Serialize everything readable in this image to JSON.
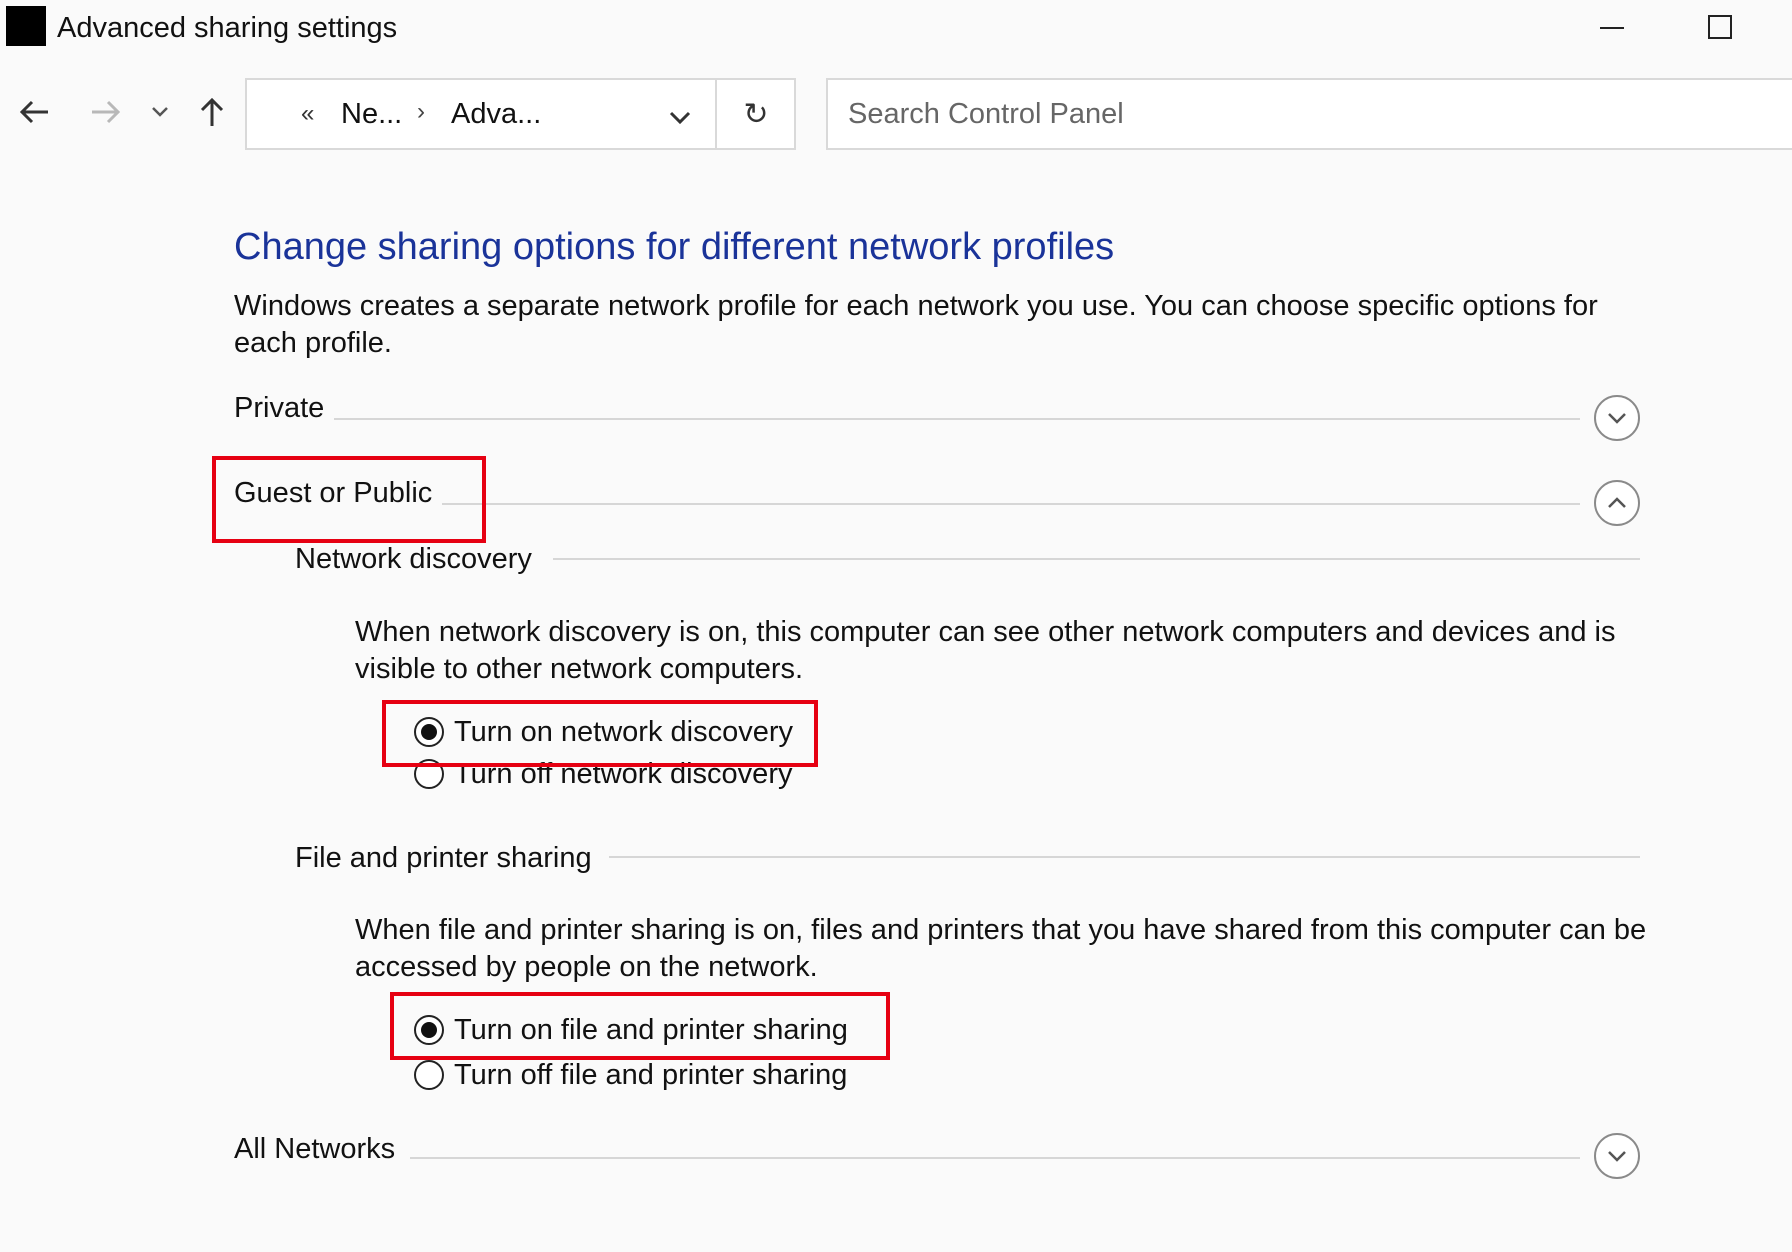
{
  "window": {
    "title": "Advanced sharing settings"
  },
  "navbar": {
    "breadcrumb_overflow": "«",
    "crumbs": [
      "Ne...",
      "Adva..."
    ],
    "crumb_separator": "›",
    "search_placeholder": "Search Control Panel"
  },
  "page": {
    "heading": "Change sharing options for different network profiles",
    "intro": "Windows creates a separate network profile for each network you use. You can choose specific options for each profile."
  },
  "profiles": {
    "private": {
      "label": "Private",
      "expanded": false
    },
    "guest_public": {
      "label": "Guest or Public",
      "expanded": true,
      "network_discovery": {
        "label": "Network discovery",
        "description": "When network discovery is on, this computer can see other network computers and devices and is visible to other network computers.",
        "options": [
          {
            "label": "Turn on network discovery",
            "checked": true
          },
          {
            "label": "Turn off network discovery",
            "checked": false
          }
        ]
      },
      "file_printer_sharing": {
        "label": "File and printer sharing",
        "description": "When file and printer sharing is on, files and printers that you have shared from this computer can be accessed by people on the network.",
        "options": [
          {
            "label": "Turn on file and printer sharing",
            "checked": true
          },
          {
            "label": "Turn off file and printer sharing",
            "checked": false
          }
        ]
      }
    },
    "all_networks": {
      "label": "All Networks",
      "expanded": false
    }
  },
  "colors": {
    "heading": "#1a3399",
    "highlight": "#e60012"
  }
}
